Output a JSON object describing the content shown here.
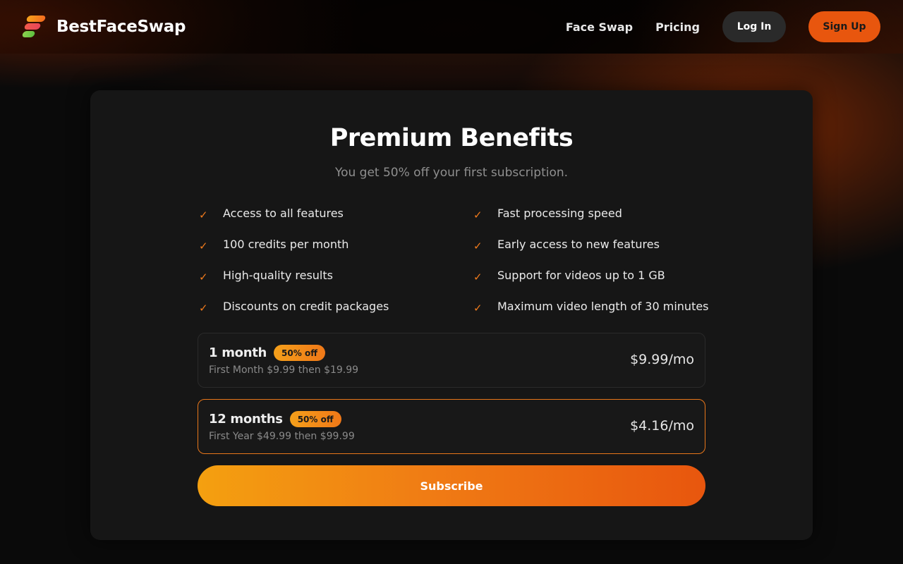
{
  "brand": {
    "name": "BestFaceSwap"
  },
  "nav": {
    "links": [
      "Face Swap",
      "Pricing"
    ],
    "login_label": "Log In",
    "signup_label": "Sign Up"
  },
  "colors": {
    "accent": "#f07a1c",
    "signup_bg": "#e8560e",
    "card_bg": "#161616",
    "page_bg": "#0a0a0a"
  },
  "card": {
    "title": "Premium Benefits",
    "subtitle": "You get 50% off your first subscription.",
    "benefits": [
      "Access to all features",
      "Fast processing speed",
      "100 credits per month",
      "Early access to new features",
      "High-quality results",
      "Support for videos up to 1 GB",
      "Discounts on credit packages",
      "Maximum video length of 30 minutes"
    ],
    "check_glyph": "✓",
    "plans": [
      {
        "name": "1 month",
        "badge": "50% off",
        "desc": "First Month $9.99 then $19.99",
        "price": "$9.99/mo",
        "selected": false
      },
      {
        "name": "12 months",
        "badge": "50% off",
        "desc": "First Year $49.99 then $99.99",
        "price": "$4.16/mo",
        "selected": true
      }
    ],
    "subscribe_label": "Subscribe"
  }
}
